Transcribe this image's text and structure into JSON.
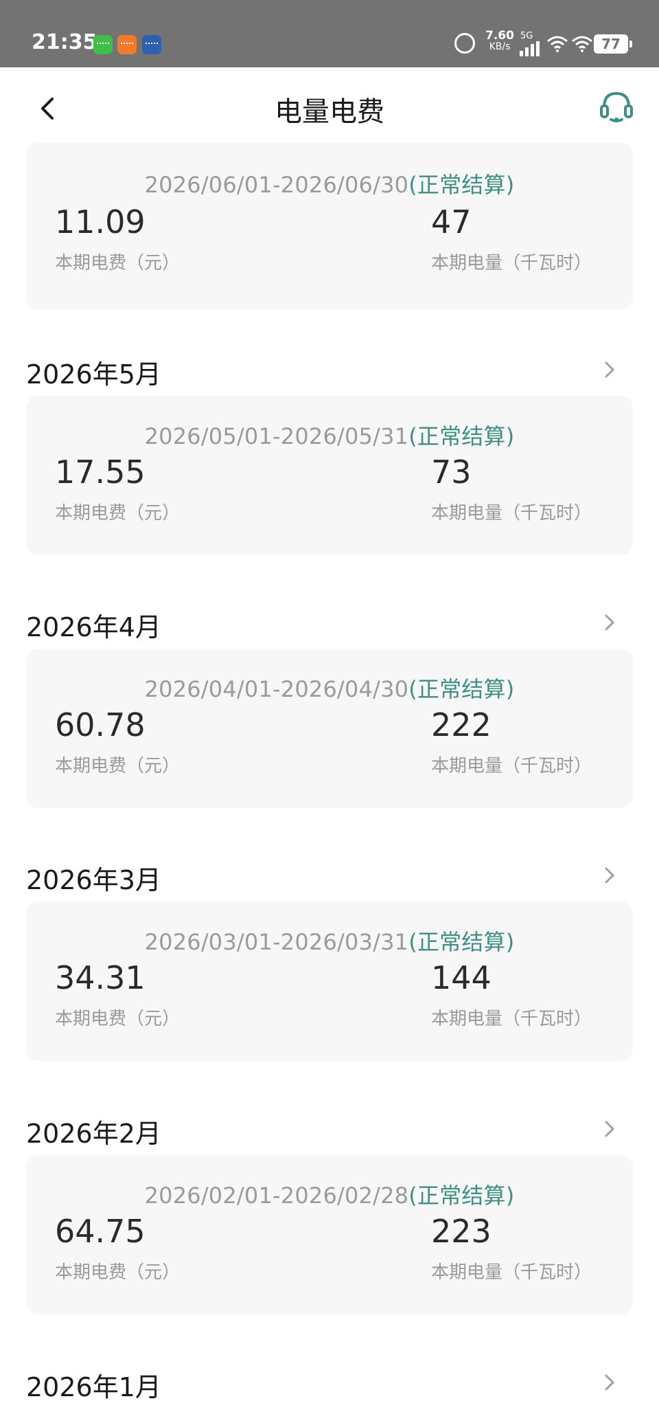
{
  "status_bar": {
    "time": "21:35",
    "net_speed_value": "7.60",
    "net_speed_unit": "KB/s",
    "network_type": "5G",
    "battery": "77",
    "apps": [
      "wechat-icon",
      "app-icon",
      "app-icon"
    ]
  },
  "header": {
    "title": "电量电费",
    "back_icon": "chevron-left-icon",
    "support_icon": "headset-icon"
  },
  "colors": {
    "accent": "#3e8f83",
    "status_bar_bg": "#737373",
    "card_bg": "#f7f7f7"
  },
  "bills": [
    {
      "month": "",
      "period": "2026/06/01-2026/06/30",
      "status": "(正常结算)",
      "fee": "11.09",
      "fee_label": "本期电费（元）",
      "kwh": "47",
      "kwh_label": "本期电量（千瓦时）"
    },
    {
      "month": "2026年5月",
      "period": "2026/05/01-2026/05/31",
      "status": "(正常结算)",
      "fee": "17.55",
      "fee_label": "本期电费（元）",
      "kwh": "73",
      "kwh_label": "本期电量（千瓦时）"
    },
    {
      "month": "2026年4月",
      "period": "2026/04/01-2026/04/30",
      "status": "(正常结算)",
      "fee": "60.78",
      "fee_label": "本期电费（元）",
      "kwh": "222",
      "kwh_label": "本期电量（千瓦时）"
    },
    {
      "month": "2026年3月",
      "period": "2026/03/01-2026/03/31",
      "status": "(正常结算)",
      "fee": "34.31",
      "fee_label": "本期电费（元）",
      "kwh": "144",
      "kwh_label": "本期电量（千瓦时）"
    },
    {
      "month": "2026年2月",
      "period": "2026/02/01-2026/02/28",
      "status": "(正常结算)",
      "fee": "64.75",
      "fee_label": "本期电费（元）",
      "kwh": "223",
      "kwh_label": "本期电量（千瓦时）"
    }
  ],
  "last_month": {
    "month": "2026年1月"
  }
}
